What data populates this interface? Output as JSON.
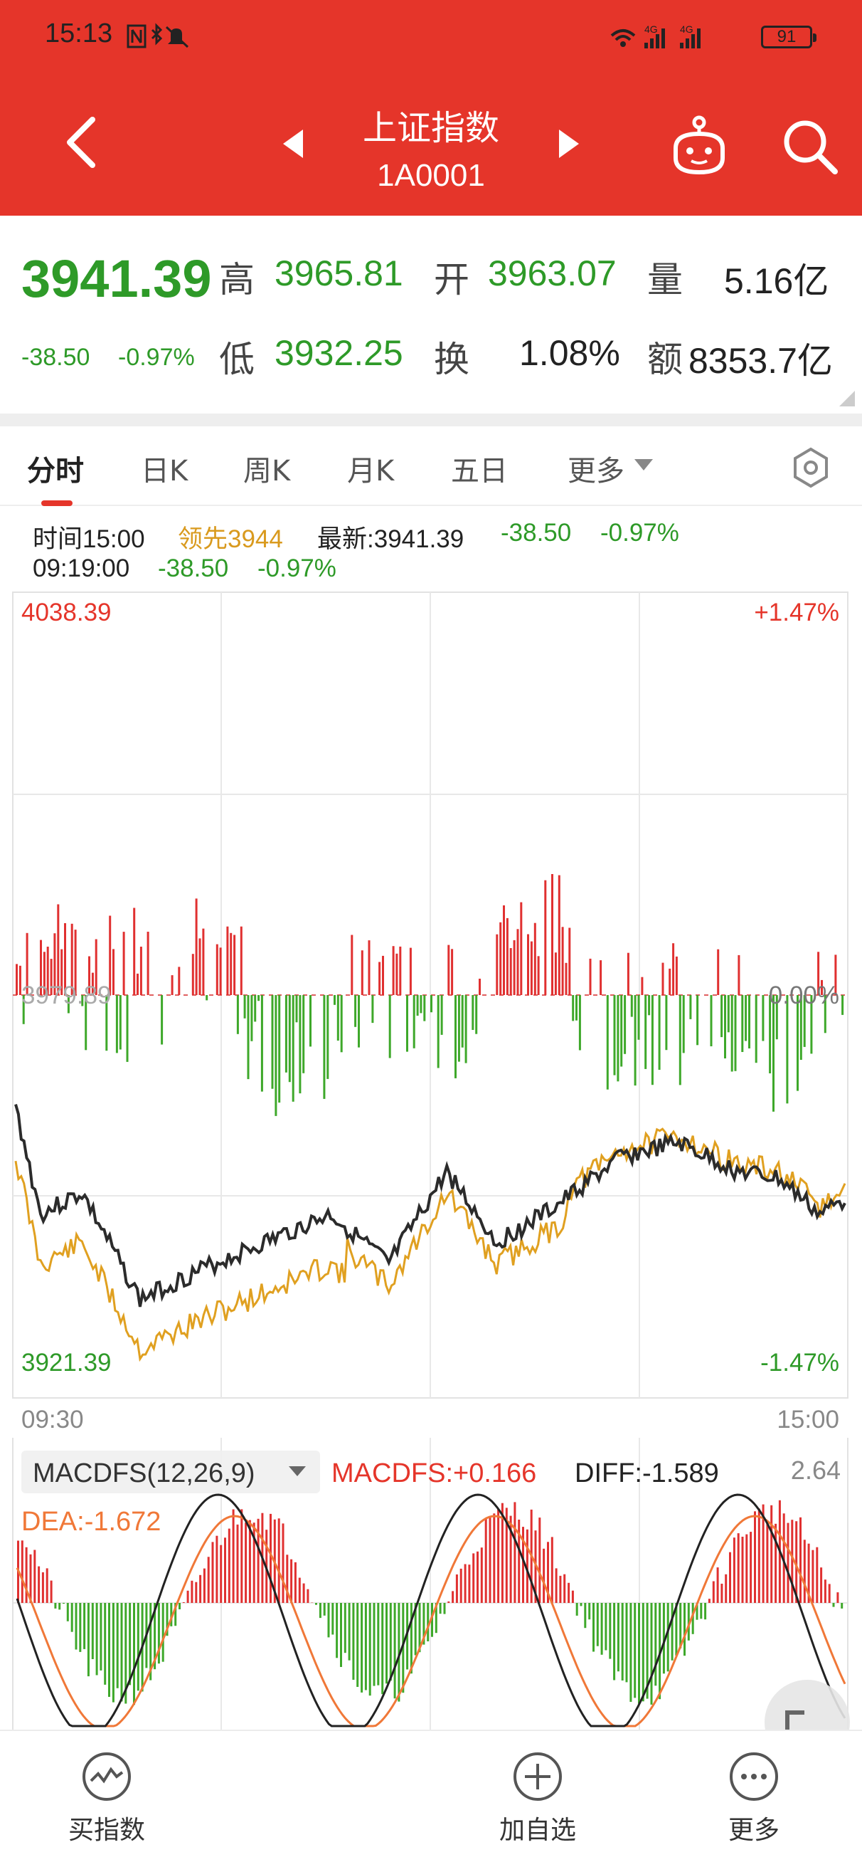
{
  "status_bar": {
    "time": "15:13",
    "battery": "91"
  },
  "header": {
    "title": "上证指数",
    "code": "1A0001"
  },
  "quote": {
    "price": "3941.39",
    "change": "-38.50",
    "change_pct": "-0.97%",
    "high_label": "高",
    "high": "3965.81",
    "low_label": "低",
    "low": "3932.25",
    "open_label": "开",
    "open": "3963.07",
    "turnover_label": "换",
    "turnover": "1.08%",
    "volume_label": "量",
    "volume": "5.16亿",
    "amount_label": "额",
    "amount": "8353.7亿"
  },
  "tabs": [
    "分时",
    "日K",
    "周K",
    "月K",
    "五日",
    "更多"
  ],
  "info": {
    "time_label": "时间15:00",
    "lead_label": "领先3944",
    "latest_label": "最新:3941.39",
    "change": "-38.50",
    "change_pct": "-0.97%",
    "line2_time": "09:19:00",
    "line2_change": "-38.50",
    "line2_pct": "-0.97%"
  },
  "chart_data": [
    {
      "type": "line",
      "name": "intraday",
      "price_high": "4038.39",
      "price_low": "3921.39",
      "price_mid": "3979.89",
      "pct_high": "+1.47%",
      "pct_low": "-1.47%",
      "pct_mid": "0.00%",
      "x_start": "09:30",
      "x_end": "15:00",
      "ylim": [
        3921.39,
        4038.39
      ],
      "colors": {
        "index_line": "#2b2b2b",
        "lead_line": "#e0a020",
        "bar_up": "#e03030",
        "bar_down": "#3ea82a"
      }
    },
    {
      "type": "bar",
      "name": "MACDFS",
      "selector_label": "MACDFS(12,26,9)",
      "macdfs_label": "MACDFS:+0.166",
      "diff_label": "DIFF:-1.589",
      "dea_label": "DEA:-1.672",
      "right_value": "2.64",
      "colors": {
        "diff_line": "#222222",
        "dea_line": "#f07838",
        "bar_up": "#e03030",
        "bar_down": "#3ea82a"
      }
    }
  ],
  "bottom_bar": {
    "buy_label": "买指数",
    "add_label": "加自选",
    "more_label": "更多"
  }
}
